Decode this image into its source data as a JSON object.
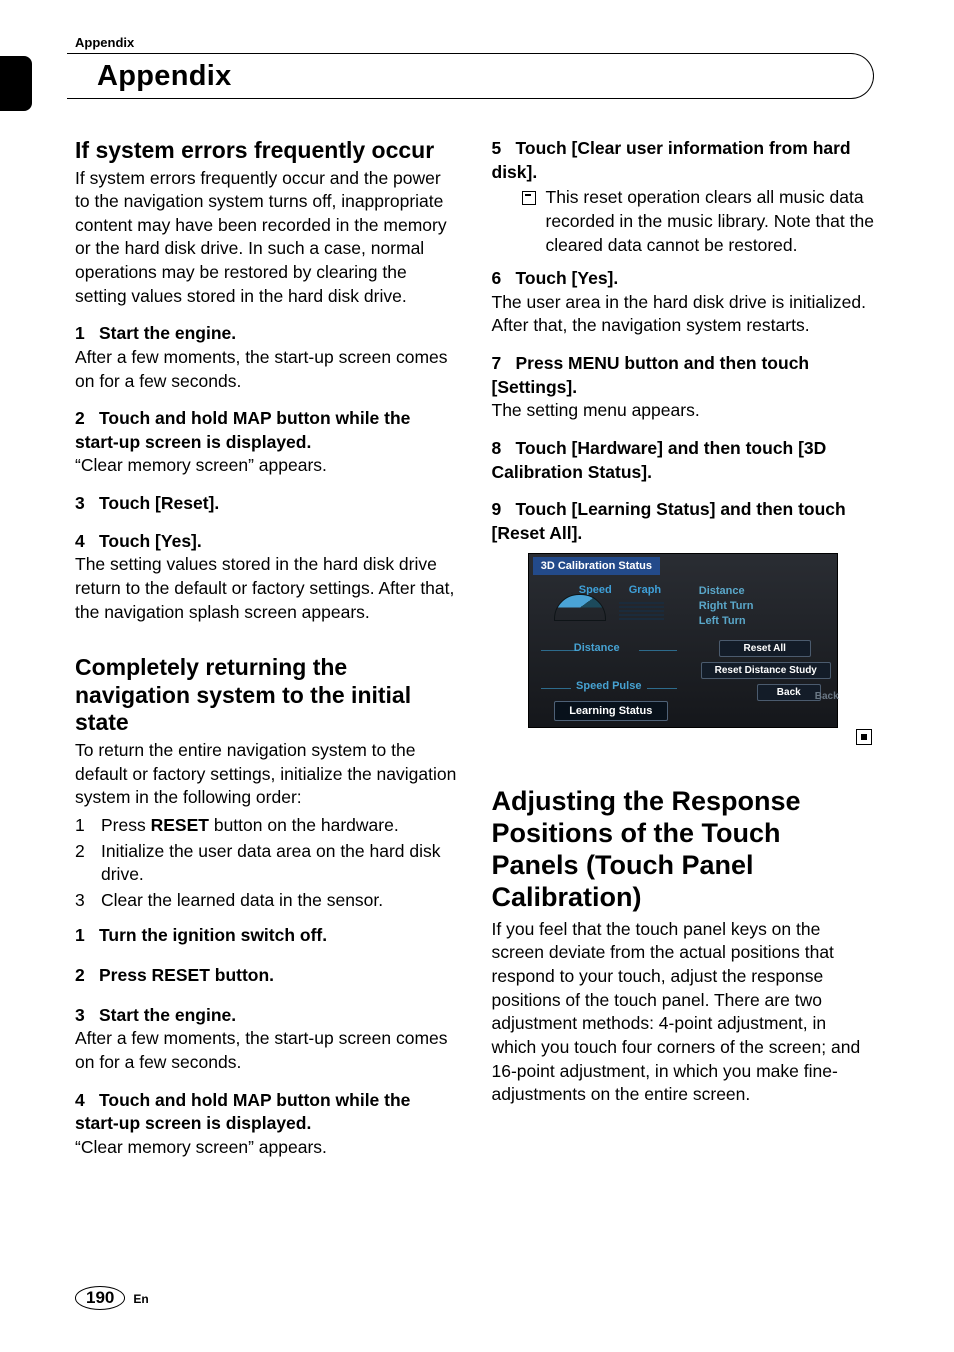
{
  "running_header": "Appendix",
  "chapter_title": "Appendix",
  "left": {
    "sec1_title": "If system errors frequently occur",
    "sec1_intro": "If system errors frequently occur and the power to the navigation system turns off, inappropriate content may have been recorded in the memory or the hard disk drive. In such a case, normal operations may be restored by clearing the setting values stored in the hard disk drive.",
    "s1": {
      "n": "1",
      "h": "Start the engine.",
      "b": "After a few moments, the start-up screen comes on for a few seconds."
    },
    "s2": {
      "n": "2",
      "h": "Touch and hold MAP button while the start-up screen is displayed.",
      "b": "“Clear memory screen” appears."
    },
    "s3": {
      "n": "3",
      "h": "Touch [Reset]."
    },
    "s4": {
      "n": "4",
      "h": "Touch [Yes].",
      "b": "The setting values stored in the hard disk drive return to the default or factory settings. After that, the navigation splash screen appears."
    },
    "sec2_title": "Completely returning the navigation system to the initial state",
    "sec2_intro": "To return the entire navigation system to the default or factory settings, initialize the navigation system in the following order:",
    "list": {
      "l1n": "1",
      "l1": "Press RESET button on the hardware.",
      "l2n": "2",
      "l2": "Initialize the user data area on the hard disk drive.",
      "l3n": "3",
      "l3": "Clear the learned data in the sensor."
    },
    "list_reset_bold": "RESET",
    "t1": {
      "n": "1",
      "h": "Turn the ignition switch off."
    },
    "t2": {
      "n": "2",
      "h": "Press RESET button."
    },
    "t3": {
      "n": "3",
      "h": "Start the engine.",
      "b": "After a few moments, the start-up screen comes on for a few seconds."
    },
    "t4": {
      "n": "4",
      "h": "Touch and hold MAP button while the start-up screen is displayed.",
      "b": "“Clear memory screen” appears."
    }
  },
  "right": {
    "s5": {
      "n": "5",
      "h": "Touch [Clear user information from hard disk]."
    },
    "note5": "This reset operation clears all music data recorded in the music library. Note that the cleared data cannot be restored.",
    "s6": {
      "n": "6",
      "h": "Touch [Yes].",
      "b": "The user area in the hard disk drive is initialized. After that, the navigation system restarts."
    },
    "s7": {
      "n": "7",
      "h": "Press MENU button and then touch [Settings].",
      "b": "The setting menu appears."
    },
    "s8": {
      "n": "8",
      "h": "Touch [Hardware] and then touch [3D Calibration Status]."
    },
    "s9": {
      "n": "9",
      "h": "Touch [Learning Status] and then touch [Reset All]."
    },
    "screen": {
      "header": "3D Calibration Status",
      "speed": "Speed",
      "graph": "Graph",
      "distance": "Distance",
      "rightturn": "Right Turn",
      "leftturn": "Left Turn",
      "distance2": "Distance",
      "speedpulse": "Speed Pulse",
      "resetall": "Reset All",
      "resetds": "Reset Distance Study",
      "back": "Back",
      "back2": "Back",
      "learning": "Learning Status"
    },
    "sec3_title": "Adjusting the Response Positions of the Touch Panels (Touch Panel Calibration)",
    "sec3_body": "If you feel that the touch panel keys on the screen deviate from the actual positions that respond to your touch, adjust the response positions of the touch panel. There are two adjustment methods: 4-point adjustment, in which you touch four corners of the screen; and 16-point adjustment, in which you make fine-adjustments on the entire screen."
  },
  "page_number": "190",
  "lang": "En"
}
